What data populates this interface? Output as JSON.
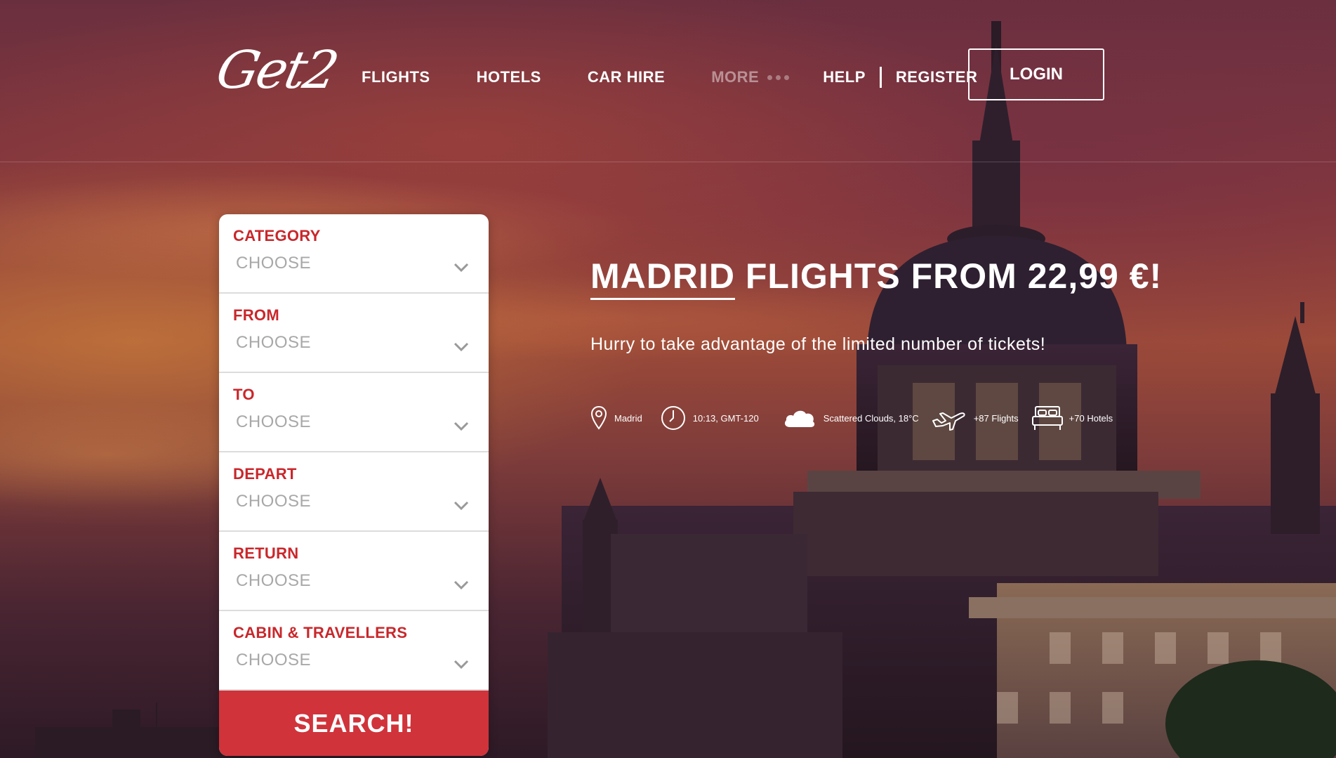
{
  "brand": {
    "logo_text": "Get2"
  },
  "nav": {
    "items": [
      {
        "label": "FLIGHTS"
      },
      {
        "label": "HOTELS"
      },
      {
        "label": "CAR HIRE"
      },
      {
        "label": "MORE"
      }
    ],
    "help_label": "HELP",
    "register_label": "REGISTER",
    "login_label": "LOGIN"
  },
  "search_form": {
    "fields": [
      {
        "label": "CATEGORY",
        "value": "CHOOSE"
      },
      {
        "label": "FROM",
        "value": "CHOOSE"
      },
      {
        "label": "TO",
        "value": "CHOOSE"
      },
      {
        "label": "DEPART",
        "value": "CHOOSE"
      },
      {
        "label": "RETURN",
        "value": "CHOOSE"
      },
      {
        "label": "CABIN & TRAVELLERS",
        "value": "CHOOSE"
      }
    ],
    "search_label": "SEARCH!"
  },
  "hero": {
    "title_city": "MADRID",
    "title_rest": " FLIGHTS FROM 22,99 €!",
    "subtitle": "Hurry to take advantage of the limited number of tickets!",
    "info": {
      "location": "Madrid",
      "time": "10:13, GMT-120",
      "weather": "Scattered Clouds, 18°C",
      "flights": "+87 Flights",
      "hotels": "+70 Hotels"
    }
  },
  "colors": {
    "accent_red": "#c9272b",
    "button_red": "#d0333a",
    "placeholder_gray": "#a8a8a8"
  },
  "icons": [
    "chevron-down-icon",
    "map-pin-icon",
    "clock-icon",
    "cloud-icon",
    "airplane-icon",
    "bed-icon"
  ]
}
